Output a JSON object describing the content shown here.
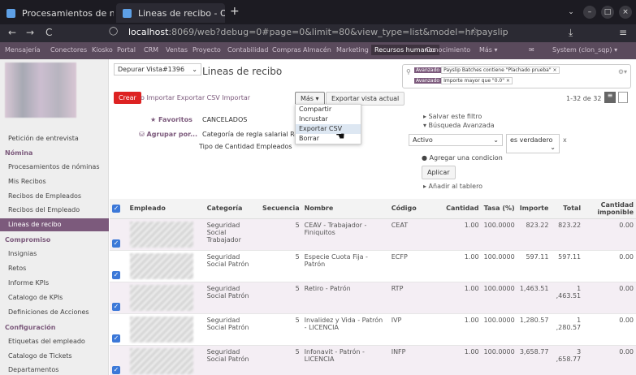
{
  "browser": {
    "tabs": [
      {
        "label": "Procesamientos de nóm",
        "close": "×"
      },
      {
        "label": "Lineas de recibo - Oper",
        "close": "×"
      }
    ],
    "new_tab": "+",
    "window_controls": [
      "⌄",
      "–",
      "□",
      "×"
    ],
    "nav": {
      "back": "←",
      "forward": "→",
      "reload": "C"
    },
    "url_host": "localhost",
    "url_rest": ":8069/web?debug=0#page=0&limit=80&view_type=list&model=hr.payslip"
  },
  "topmenu": {
    "items": [
      "Mensajería",
      "Conectores",
      "Kiosko",
      "Portal",
      "CRM",
      "Ventas",
      "Proyecto",
      "Contabilidad",
      "Compras",
      "Almacén",
      "Marketing",
      "Recursos humanos",
      "Conocimiento",
      "Más ▾"
    ],
    "active": "Recursos humanos",
    "user": "System (clon_sqp) ▾"
  },
  "sidebar": {
    "items": [
      {
        "label": "Petición de entrevista",
        "type": "item"
      },
      {
        "label": "Nómina",
        "type": "head"
      },
      {
        "label": "Procesamientos de nóminas",
        "type": "item"
      },
      {
        "label": "Mis Recibos",
        "type": "item"
      },
      {
        "label": "Recibos de Empleados",
        "type": "item"
      },
      {
        "label": "Recibos del Empleado",
        "type": "item"
      },
      {
        "label": "Lineas de recibo",
        "type": "active"
      },
      {
        "label": "Compromiso",
        "type": "head"
      },
      {
        "label": "Insignias",
        "type": "item"
      },
      {
        "label": "Retos",
        "type": "item"
      },
      {
        "label": "Informe KPIs",
        "type": "item"
      },
      {
        "label": "Catalogo de KPIs",
        "type": "item"
      },
      {
        "label": "Definiciones de Acciones",
        "type": "item"
      },
      {
        "label": "Configuración",
        "type": "head"
      },
      {
        "label": "Etiquetas del empleado",
        "type": "item"
      },
      {
        "label": "Catalogo de Tickets",
        "type": "item"
      },
      {
        "label": "Departamentos",
        "type": "item"
      }
    ]
  },
  "main": {
    "debug_select": "Depurar Vista#1396",
    "title": "Lineas de recibo",
    "search_facets": [
      {
        "tag": "Avanzado",
        "value": "Payslip Batches contiene \"Plachado prueba\" ×"
      },
      {
        "tag": "Avanzado",
        "value": "Importe mayor que \"0.0\" ×"
      }
    ],
    "create": "Crear",
    "import": "o Importar Exportar CSV Importar",
    "mas": "Más ▾",
    "export_view": "Exportar vista actual",
    "dropdown": [
      "Compartir",
      "Incrustar",
      "Exportar CSV",
      "Borrar"
    ],
    "pager": "1-32 de 32",
    "favoritos": "★ Favoritos",
    "agrupar": "Agrupar por...",
    "cancelados": "CANCELADOS",
    "group_options": "Categoría de regla salarial  Regla",
    "group_options2": "Tipo de Cantidad  Empleados",
    "save_filter": "▸ Salvar este filtro",
    "adv_search": "▾ Búsqueda Avanzada",
    "filter_field": "Activo",
    "filter_op": "es verdadero",
    "filter_x": "x",
    "add_condition": "Agregar una condicion",
    "apply": "Aplicar",
    "add_dashboard": "▸ Añadir al tablero"
  },
  "table": {
    "headers": [
      "",
      "Empleado",
      "Categoría",
      "Secuencia",
      "Nombre",
      "Código",
      "Cantidad",
      "Tasa (%)",
      "Importe",
      "Total",
      "Cantidad imponible"
    ],
    "rows": [
      {
        "categoria": "Seguridad Social Trabajador",
        "secuencia": "5",
        "nombre": "CEAV - Trabajador - Finiquitos",
        "codigo": "CEAT",
        "cantidad": "1.00",
        "tasa": "100.0000",
        "importe": "823.22",
        "total": "823.22",
        "imponible": "0.00"
      },
      {
        "categoria": "Seguridad Social Patrón",
        "secuencia": "5",
        "nombre": "Especie Cuota Fija - Patrón",
        "codigo": "ECFP",
        "cantidad": "1.00",
        "tasa": "100.0000",
        "importe": "597.11",
        "total": "597.11",
        "imponible": "0.00"
      },
      {
        "categoria": "Seguridad Social Patrón",
        "secuencia": "5",
        "nombre": "Retiro - Patrón",
        "codigo": "RTP",
        "cantidad": "1.00",
        "tasa": "100.0000",
        "importe": "1,463.51",
        "total": "1 ,463.51",
        "imponible": "0.00"
      },
      {
        "categoria": "Seguridad Social Patrón",
        "secuencia": "5",
        "nombre": "Invalidez y Vida - Patrón - LICENCIA",
        "codigo": "IVP",
        "cantidad": "1.00",
        "tasa": "100.0000",
        "importe": "1,280.57",
        "total": "1 ,280.57",
        "imponible": "0.00"
      },
      {
        "categoria": "Seguridad Social Patrón",
        "secuencia": "5",
        "nombre": "Infonavit - Patrón - LICENCIA",
        "codigo": "INFP",
        "cantidad": "1.00",
        "tasa": "100.0000",
        "importe": "3,658.77",
        "total": "3 ,658.77",
        "imponible": "0.00"
      }
    ]
  }
}
